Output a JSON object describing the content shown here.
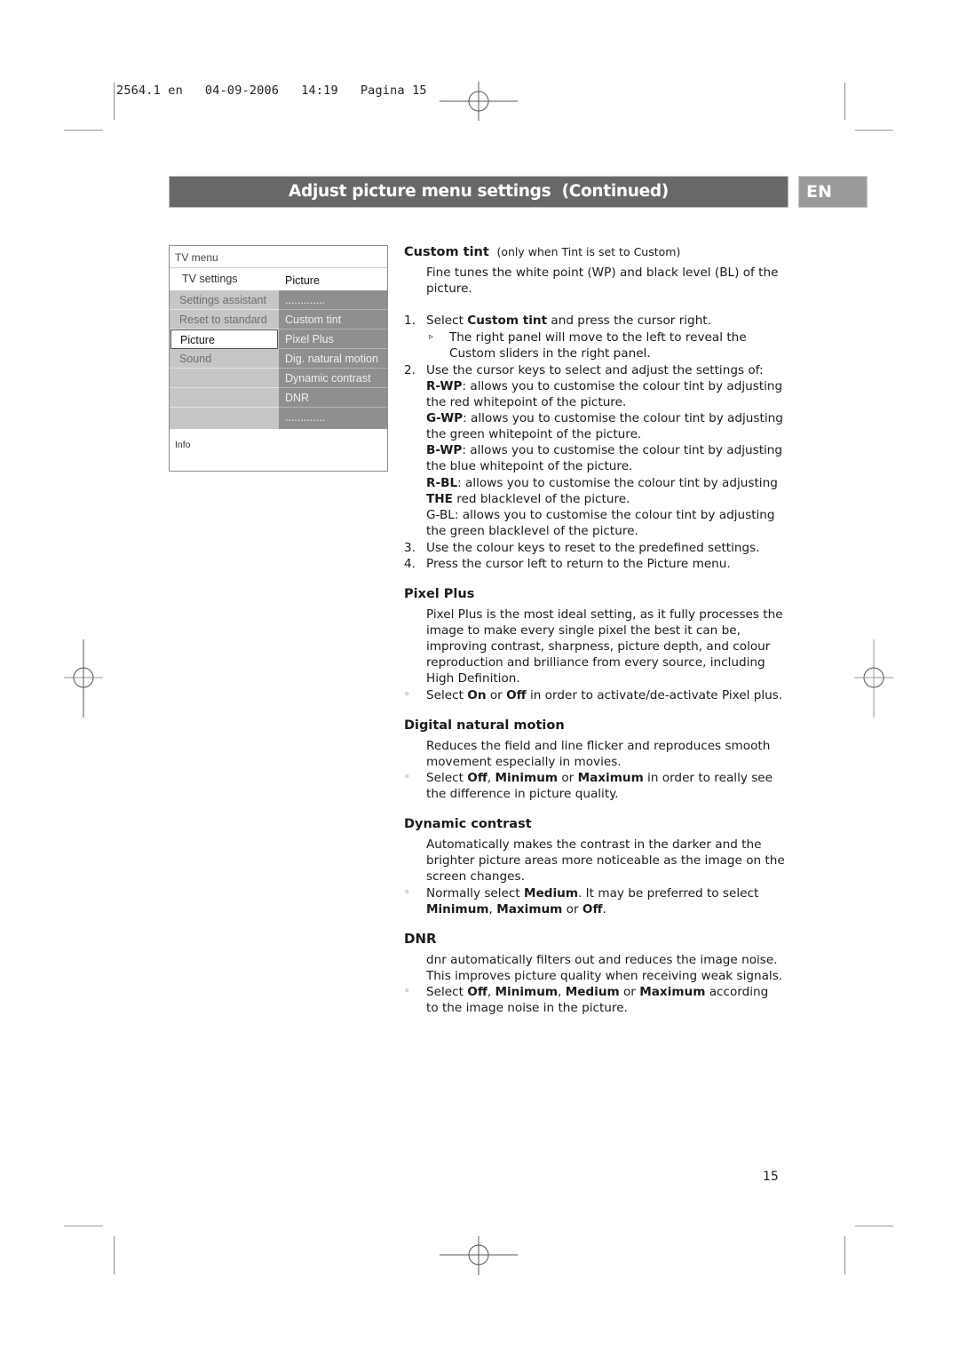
{
  "slug": "2564.1 en   04-09-2006   14:19   Pagina 15",
  "header": {
    "title": "Adjust picture menu settings  (Continued)",
    "language_badge": "EN",
    "bar_color": "#686868",
    "badge_color": "#9a9a9a"
  },
  "tv_menu": {
    "title": "TV menu",
    "submenu_left": "TV settings",
    "submenu_right": "Picture",
    "left_items": [
      {
        "label": "Settings assistant",
        "selected": false
      },
      {
        "label": "Reset to standard",
        "selected": false
      },
      {
        "label": "Picture",
        "selected": true
      },
      {
        "label": "Sound",
        "selected": false
      },
      {
        "label": ""
      },
      {
        "label": ""
      },
      {
        "label": ""
      }
    ],
    "right_items": [
      {
        "label": "............."
      },
      {
        "label": "Custom tint"
      },
      {
        "label": "Pixel Plus"
      },
      {
        "label": "Dig. natural motion"
      },
      {
        "label": "Dynamic contrast"
      },
      {
        "label": "DNR"
      },
      {
        "label": "............."
      }
    ],
    "info_label": "Info"
  },
  "sections": {
    "custom_tint": {
      "heading": "Custom tint",
      "heading_note": "(only when Tint is set to Custom)",
      "intro_1": "Fine tunes the white point (WP) and black level (BL) of the",
      "intro_2": "picture.",
      "step1_num": "1.",
      "step1_pre": "Select ",
      "step1_bold": "Custom tint",
      "step1_post": " and press the cursor right.",
      "step1_arrow": "▹",
      "step1_sub_1": "The right panel will move to the left to reveal the",
      "step1_sub_2": "Custom sliders in the right panel.",
      "step2_num": "2.",
      "step2_text": "Use the cursor keys to select and adjust the settings of:",
      "rwp_bold": "R-WP",
      "rwp_text": ": allows you to customise the colour tint by adjusting",
      "rwp_text2": "the red whitepoint of the picture.",
      "gwp_bold": "G-WP",
      "gwp_text": ": allows you to customise the colour tint by adjusting",
      "gwp_text2": "the green whitepoint of the picture.",
      "bwp_bold": "B-WP",
      "bwp_text": ": allows you to customise the colour tint by adjusting",
      "bwp_text2": "the blue whitepoint of the picture.",
      "rbl_bold": "R-BL",
      "rbl_text": ": allows you to customise the colour tint by adjusting",
      "rbl_bold2": "THE",
      "rbl_text2": " red blacklevel of the picture.",
      "gbl_text": "G-BL: allows you to customise the colour tint by adjusting",
      "gbl_text2": "the green blacklevel of the picture.",
      "step3_num": "3.",
      "step3_text": "Use the colour keys to reset to the predefined settings.",
      "step4_num": "4.",
      "step4_text": "Press the cursor left to return to the Picture menu."
    },
    "pixel_plus": {
      "heading": "Pixel Plus",
      "p1": "Pixel Plus is the most ideal setting, as it fully processes the",
      "p2": "image to make every single pixel the best it can be,",
      "p3": "improving contrast, sharpness, picture depth, and colour",
      "p4": "reproduction and brilliance from every source, including",
      "p5": "High Definition.",
      "bullet": "◦",
      "b_pre": "Select ",
      "b_on": "On",
      "b_or": " or ",
      "b_off": "Off",
      "b_post": " in order to activate/de-activate Pixel plus."
    },
    "dnm": {
      "heading": "Digital natural motion",
      "p1": "Reduces the field and line flicker and reproduces smooth",
      "p2": "movement especially in movies.",
      "bullet": "◦",
      "b_pre": "Select ",
      "b_off": "Off",
      "b_c1": ", ",
      "b_min": "Minimum",
      "b_or": " or ",
      "b_max": "Maximum",
      "b_post": " in order to really see",
      "b_line2": "the difference in picture quality."
    },
    "dynamic_contrast": {
      "heading": "Dynamic contrast",
      "p1": "Automatically makes the contrast in the darker and the",
      "p2": "brighter picture areas more noticeable as the image on the",
      "p3": "screen changes.",
      "bullet": "◦",
      "b_pre": "Normally select ",
      "b_med": "Medium",
      "b_post": ". It may be preferred to select",
      "b2_min": "Minimum",
      "b2_c": ", ",
      "b2_max": "Maximum",
      "b2_or": " or ",
      "b2_off": "Off",
      "b2_end": "."
    },
    "dnr": {
      "heading": "DNR",
      "p1": "dnr automatically filters out and reduces the image noise.",
      "p2": "This improves picture quality when receiving weak signals.",
      "bullet": "◦",
      "b_pre": "Select ",
      "b_off": "Off",
      "b_c1": ", ",
      "b_min": "Minimum",
      "b_c2": ", ",
      "b_med": "Medium",
      "b_or": " or ",
      "b_max": "Maximum",
      "b_post": " according",
      "b_line2": "to the image noise in the picture."
    }
  },
  "page_number": "15"
}
